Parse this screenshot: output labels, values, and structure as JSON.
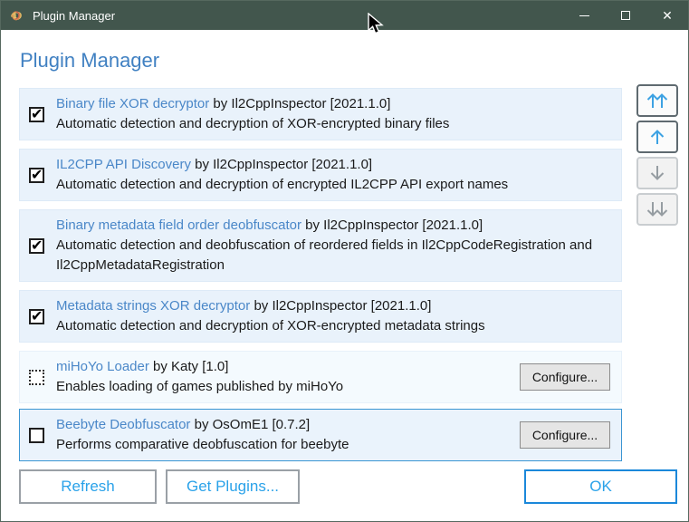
{
  "window": {
    "title": "Plugin Manager"
  },
  "header": {
    "title": "Plugin Manager"
  },
  "plugins": [
    {
      "name": "Binary file XOR decryptor",
      "byline": "by Il2CppInspector [2021.1.0]",
      "description": "Automatic detection and decryption of XOR-encrypted binary files",
      "checkbox_state": "checked"
    },
    {
      "name": "IL2CPP API Discovery",
      "byline": "by Il2CppInspector [2021.1.0]",
      "description": "Automatic detection and decryption of encrypted IL2CPP API export names",
      "checkbox_state": "checked"
    },
    {
      "name": "Binary metadata field order deobfuscator",
      "byline": "by Il2CppInspector [2021.1.0]",
      "description": "Automatic detection and deobfuscation of reordered fields in Il2CppCodeRegistration and Il2CppMetadataRegistration",
      "checkbox_state": "checked"
    },
    {
      "name": "Metadata strings XOR decryptor",
      "byline": "by Il2CppInspector [2021.1.0]",
      "description": "Automatic detection and decryption of XOR-encrypted metadata strings",
      "checkbox_state": "checked"
    },
    {
      "name": "miHoYo Loader",
      "byline": "by Katy [1.0]",
      "description": "Enables loading of games published by miHoYo",
      "checkbox_state": "indeterminate",
      "configure_label": "Configure..."
    },
    {
      "name": "Beebyte Deobfuscator",
      "byline": "by OsOmE1 [0.7.2]",
      "description": "Performs comparative deobfuscation for beebyte",
      "checkbox_state": "unchecked",
      "selected": true,
      "configure_label": "Configure..."
    }
  ],
  "move_buttons": {
    "move_to_top_icon": "double-up-arrow",
    "move_up_icon": "up-arrow",
    "move_down_icon": "down-arrow",
    "move_to_bottom_icon": "double-down-arrow",
    "enabled": [
      "move_to_top",
      "move_up"
    ],
    "disabled": [
      "move_down",
      "move_to_bottom"
    ]
  },
  "footer": {
    "refresh_label": "Refresh",
    "get_plugins_label": "Get Plugins...",
    "ok_label": "OK"
  },
  "colors": {
    "titlebar": "#42564d",
    "heading_blue": "#4181c2",
    "link_blue": "#4a87c8",
    "action_blue": "#2aa2e9",
    "ok_border_blue": "#1b88da",
    "row_background": "#e9f2fb",
    "selected_row_border": "#3b96d3",
    "arrow_enabled_blue": "#3da2e3",
    "arrow_disabled_gray": "#969da2"
  }
}
